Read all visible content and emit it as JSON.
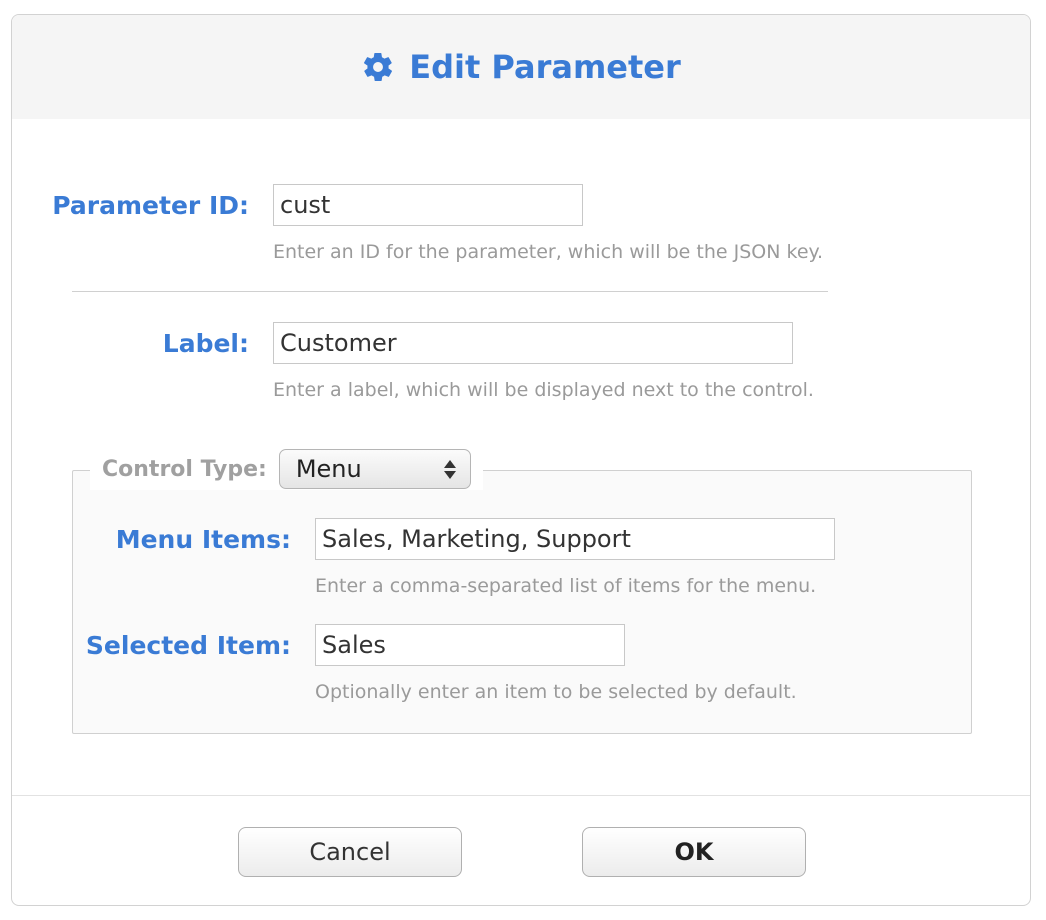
{
  "dialog": {
    "title": "Edit Parameter",
    "icon": "gear-icon",
    "accent_color": "#3a7bd5"
  },
  "parameter_id": {
    "label": "Parameter ID:",
    "value": "cust",
    "help": "Enter an ID for the parameter, which will be the JSON key."
  },
  "label_field": {
    "label": "Label:",
    "value": "Customer",
    "help": "Enter a label, which will be displayed next to the control."
  },
  "control_type": {
    "label": "Control Type:",
    "selected": "Menu"
  },
  "menu_items": {
    "label": "Menu Items:",
    "value": "Sales, Marketing, Support",
    "help": "Enter a comma-separated list of items for the menu."
  },
  "selected_item": {
    "label": "Selected Item:",
    "value": "Sales",
    "help": "Optionally enter an item to be selected by default."
  },
  "buttons": {
    "cancel": "Cancel",
    "ok": "OK"
  }
}
